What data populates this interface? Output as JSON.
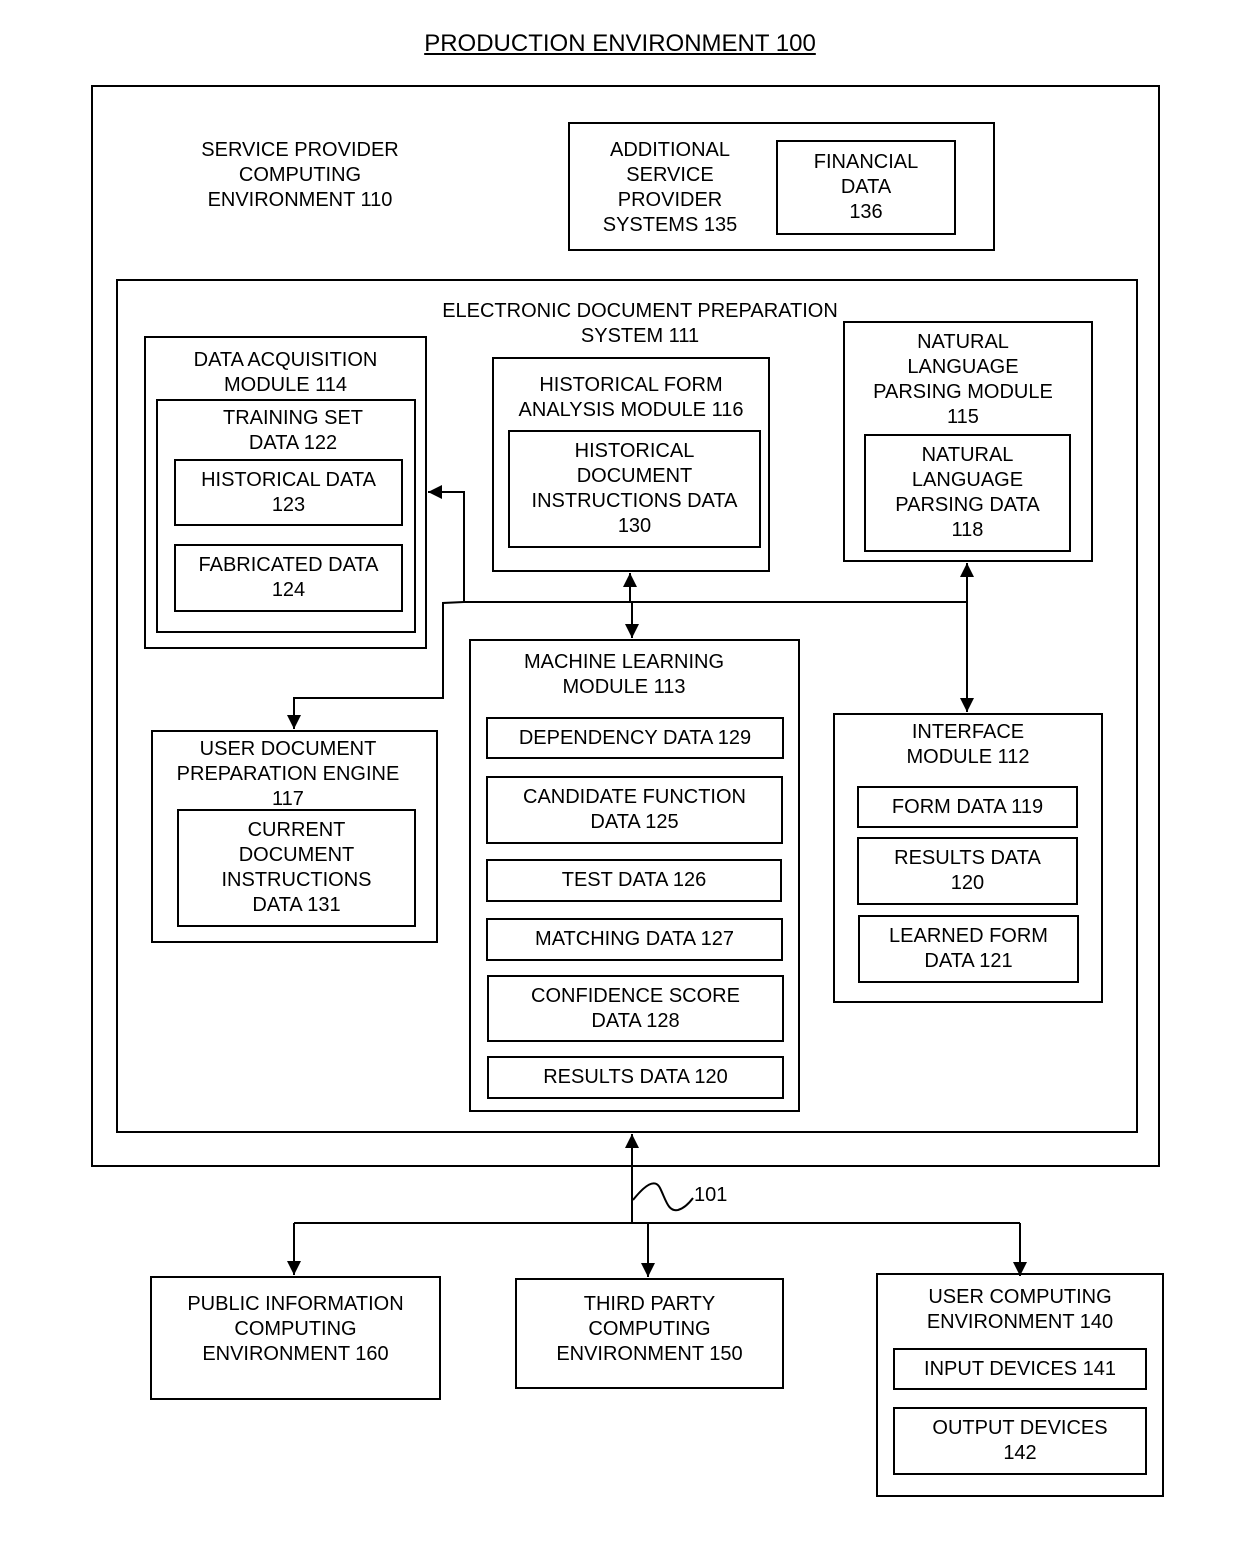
{
  "title": "PRODUCTION ENVIRONMENT 100",
  "service_provider": {
    "label": "SERVICE PROVIDER\nCOMPUTING\nENVIRONMENT 110",
    "additional_systems": {
      "label": "ADDITIONAL\nSERVICE\nPROVIDER\nSYSTEMS 135",
      "financial_data": "FINANCIAL\nDATA\n136"
    },
    "edps": {
      "label": "ELECTRONIC DOCUMENT PREPARATION\nSYSTEM  111",
      "data_acquisition": {
        "label": "DATA ACQUISITION\nMODULE 114",
        "training_set": {
          "label": "TRAINING SET\nDATA 122",
          "items": [
            "HISTORICAL DATA\n123",
            "FABRICATED DATA\n124"
          ]
        }
      },
      "historical_form": {
        "label": "HISTORICAL FORM\nANALYSIS MODULE 116",
        "items": [
          "HISTORICAL\nDOCUMENT\nINSTRUCTIONS DATA\n130"
        ]
      },
      "nlp": {
        "label": "NATURAL\nLANGUAGE\nPARSING MODULE\n115",
        "items": [
          "NATURAL\nLANGUAGE\nPARSING DATA\n118"
        ]
      },
      "user_doc_engine": {
        "label": "USER DOCUMENT\nPREPARATION  ENGINE\n117",
        "items": [
          "CURRENT\nDOCUMENT\nINSTRUCTIONS\nDATA 131"
        ]
      },
      "ml_module": {
        "label": "MACHINE LEARNING\nMODULE 113",
        "items": [
          "DEPENDENCY DATA 129",
          "CANDIDATE FUNCTION\nDATA 125",
          "TEST DATA 126",
          "MATCHING DATA 127",
          "CONFIDENCE SCORE\nDATA 128",
          "RESULTS DATA 120"
        ]
      },
      "interface": {
        "label": "INTERFACE\nMODULE 112",
        "items": [
          "FORM DATA 119",
          "RESULTS DATA\n120",
          "LEARNED FORM\nDATA 121"
        ]
      }
    }
  },
  "network_label": "101",
  "public_info": "PUBLIC INFORMATION\nCOMPUTING\nENVIRONMENT 160",
  "third_party": "THIRD PARTY\nCOMPUTING\nENVIRONMENT 150",
  "user_computing": {
    "label": "USER COMPUTING\nENVIRONMENT 140",
    "items": [
      "INPUT DEVICES 141",
      "OUTPUT DEVICES\n142"
    ]
  }
}
